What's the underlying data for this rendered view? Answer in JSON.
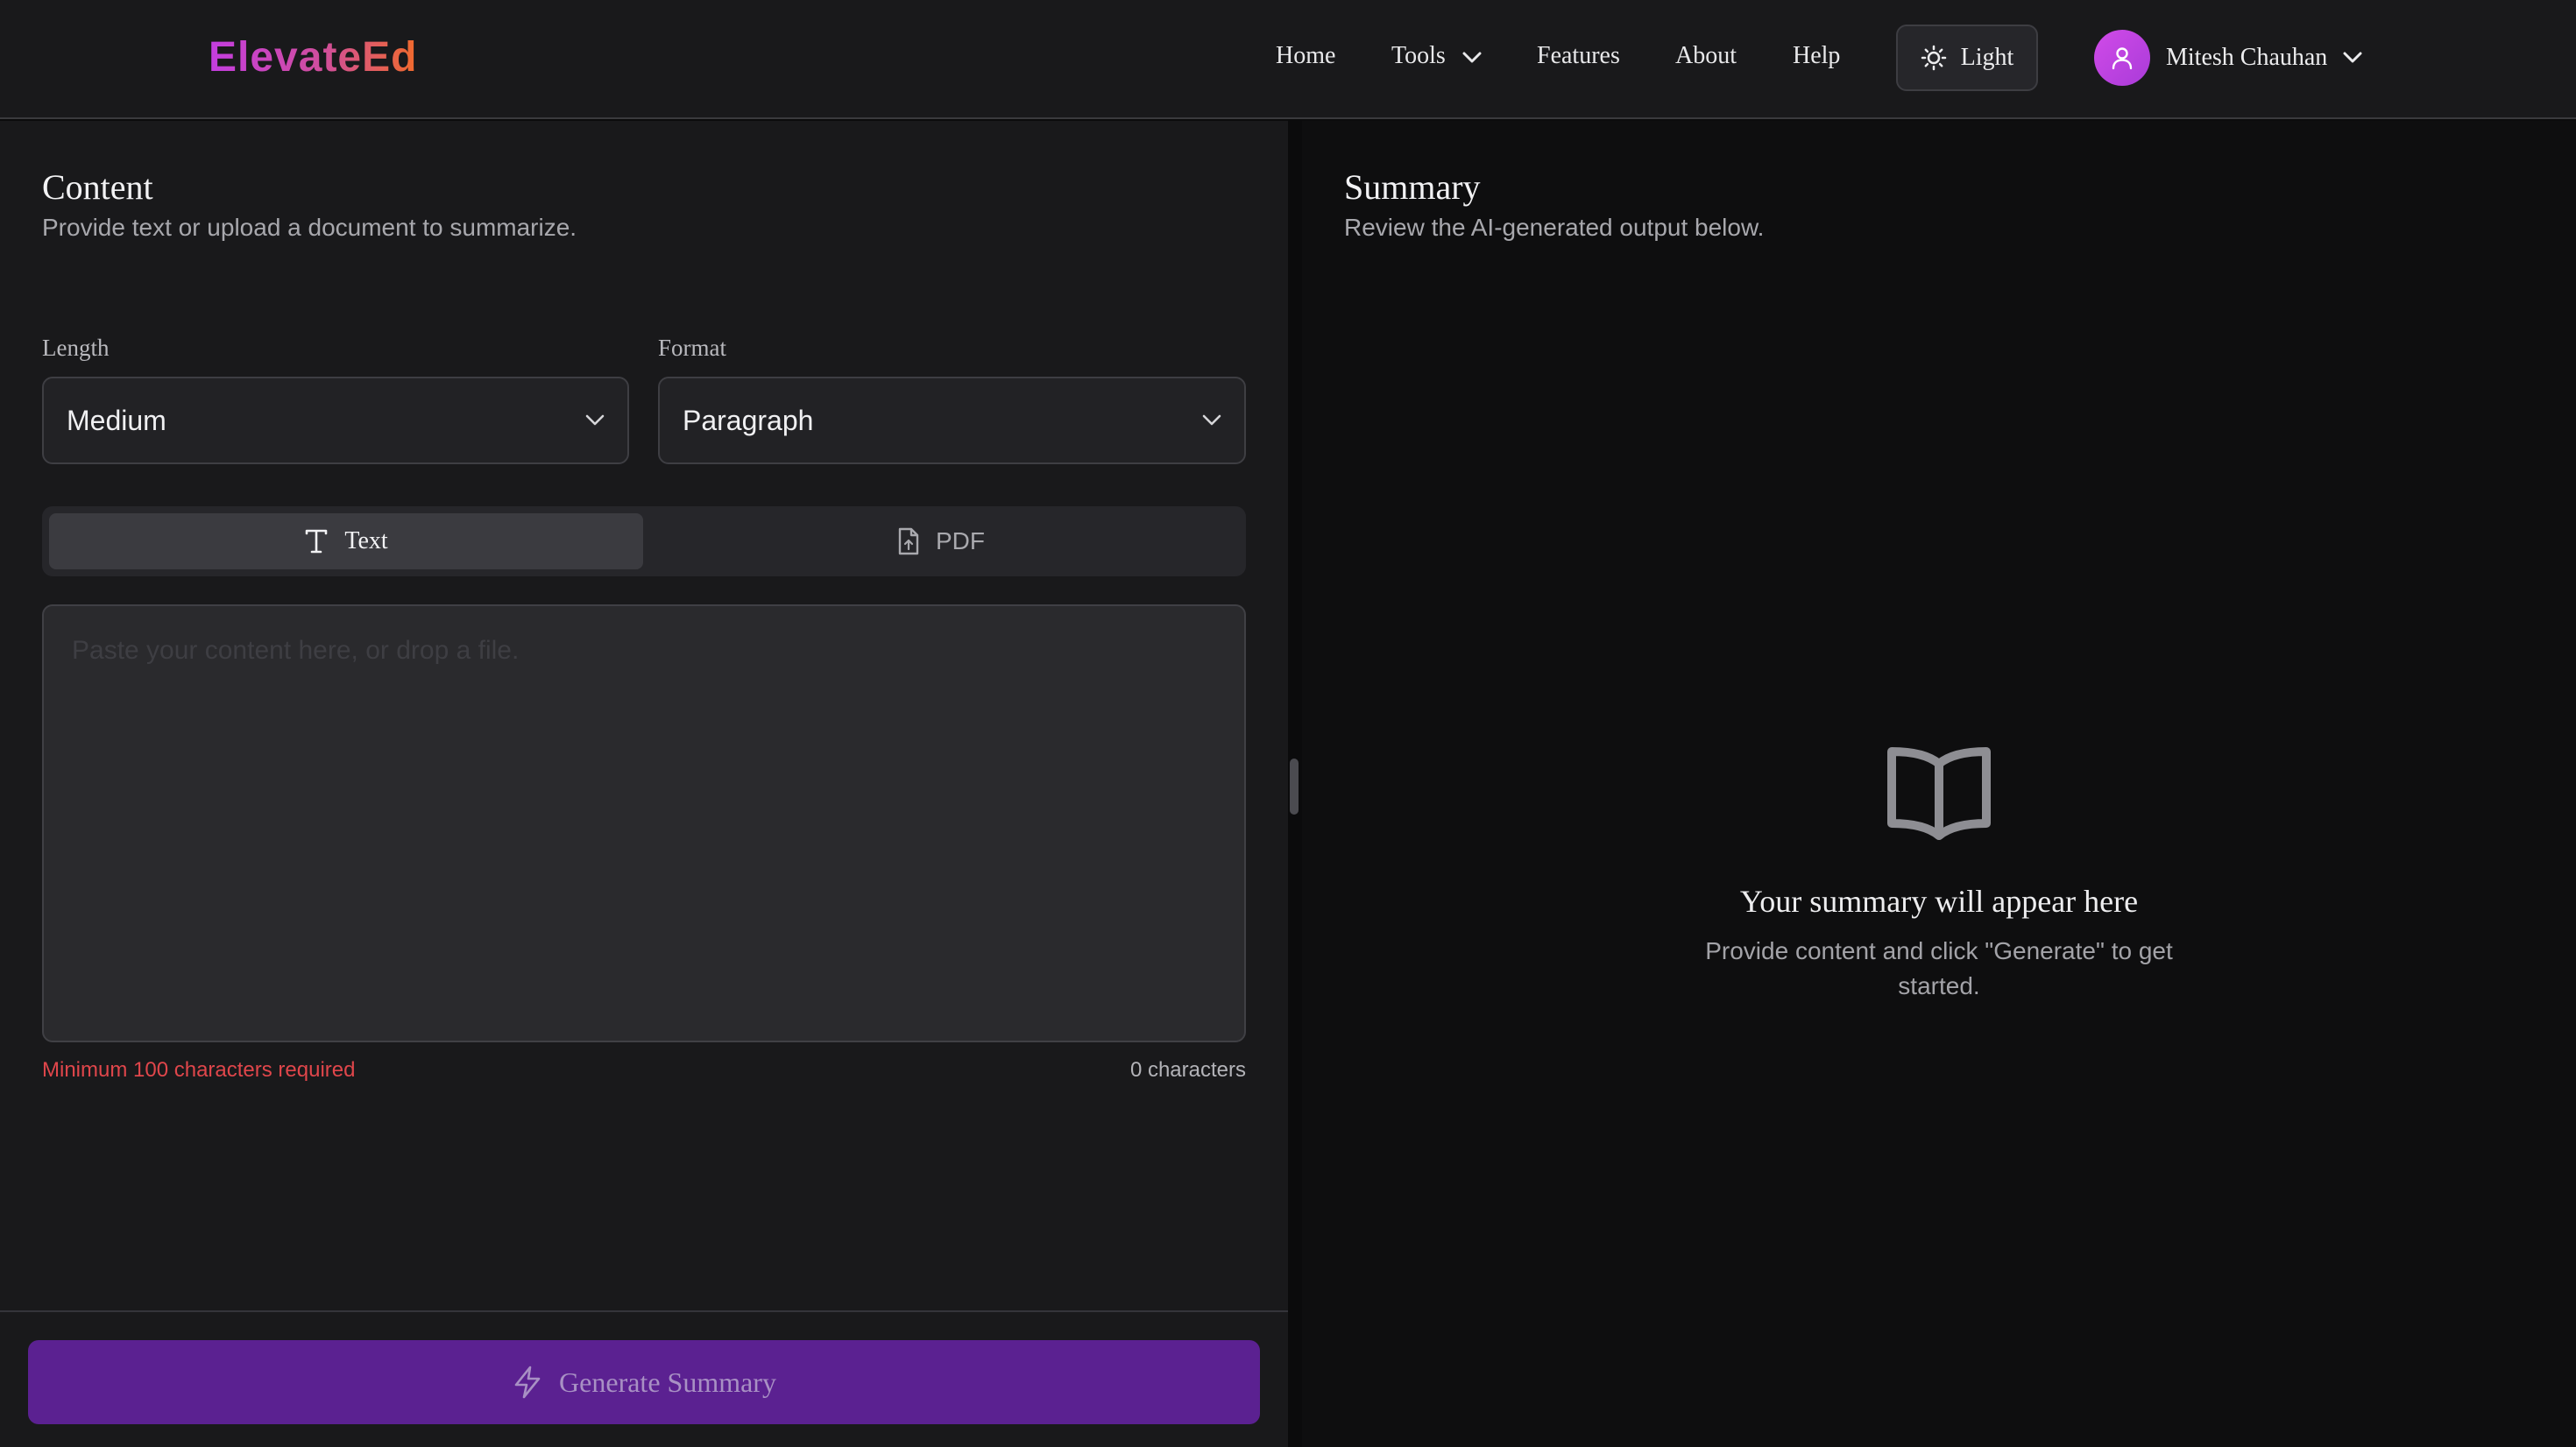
{
  "app": {
    "logo": "ElevateEd"
  },
  "nav": {
    "items": [
      {
        "label": "Home"
      },
      {
        "label": "Tools"
      },
      {
        "label": "Features"
      },
      {
        "label": "About"
      },
      {
        "label": "Help"
      }
    ],
    "theme_toggle": {
      "label": "Light",
      "icon": "sun-icon"
    },
    "user": {
      "name": "Mitesh Chauhan",
      "icon": "user-icon"
    }
  },
  "content_panel": {
    "title": "Content",
    "subtitle": "Provide text or upload a document to summarize.",
    "length": {
      "label": "Length",
      "value": "Medium"
    },
    "format": {
      "label": "Format",
      "value": "Paragraph"
    },
    "tabs": [
      {
        "label": "Text",
        "icon": "text-icon",
        "active": true
      },
      {
        "label": "PDF",
        "icon": "file-icon",
        "active": false
      }
    ],
    "input": {
      "placeholder": "Paste your content here, or drop a file.",
      "value": ""
    },
    "validation": "Minimum 100 characters required",
    "char_count": "0 characters",
    "generate_label": "Generate Summary"
  },
  "summary_panel": {
    "title": "Summary",
    "subtitle": "Review the AI-generated output below.",
    "empty_title": "Your summary will appear here",
    "empty_desc": "Provide content and click \"Generate\" to get started."
  },
  "colors": {
    "accent": "#5b2191",
    "error": "#e0464b",
    "logo_gradient": [
      "#c33de0",
      "#f06a2c"
    ]
  }
}
